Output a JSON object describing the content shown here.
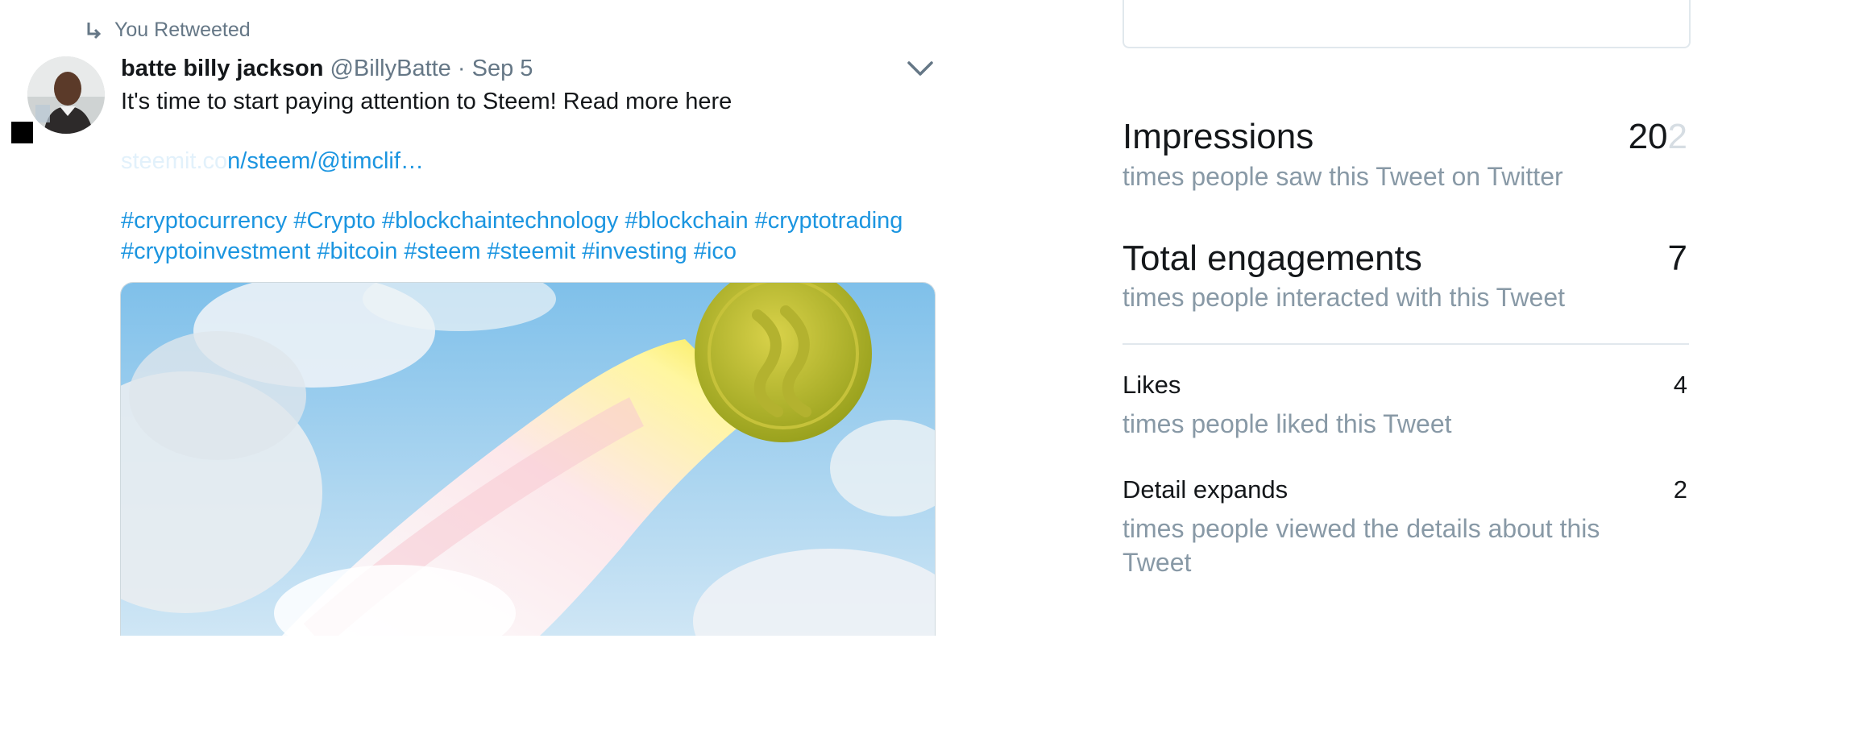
{
  "tweet": {
    "retweet_label": "You Retweeted",
    "author_name": "batte billy jackson",
    "author_handle": "@BillyBatte",
    "separator": "·",
    "date": "Sep 5",
    "text": "It's time to start paying attention to Steem! Read more here",
    "link_faded": "steemit.co",
    "link_visible": "n/steem/@timclif…",
    "hashtags_line1": "#cryptocurrency #Crypto #blockchaintechnology #blockchain #cryptotrading",
    "hashtags_line2": "#cryptoinvestment #bitcoin #steem #steemit #investing #ico"
  },
  "analytics": {
    "impressions": {
      "label": "Impressions",
      "value_main": "20",
      "value_cut": "2",
      "desc": "times people saw this Tweet on Twitter"
    },
    "engagements": {
      "label": "Total engagements",
      "value": "7",
      "desc": "times people interacted with this Tweet"
    },
    "likes": {
      "label": "Likes",
      "value": "4",
      "desc": "times people liked this Tweet"
    },
    "detail_expands": {
      "label": "Detail expands",
      "value": "2",
      "desc_line1": "times people viewed the details about this",
      "desc_line2": "Tweet"
    }
  },
  "colors": {
    "link": "#1b95e0",
    "muted": "#657786",
    "desc": "#8899a6",
    "divider": "#e1e8ed"
  },
  "icons": [
    "retweet-icon",
    "chevron-down-icon"
  ]
}
